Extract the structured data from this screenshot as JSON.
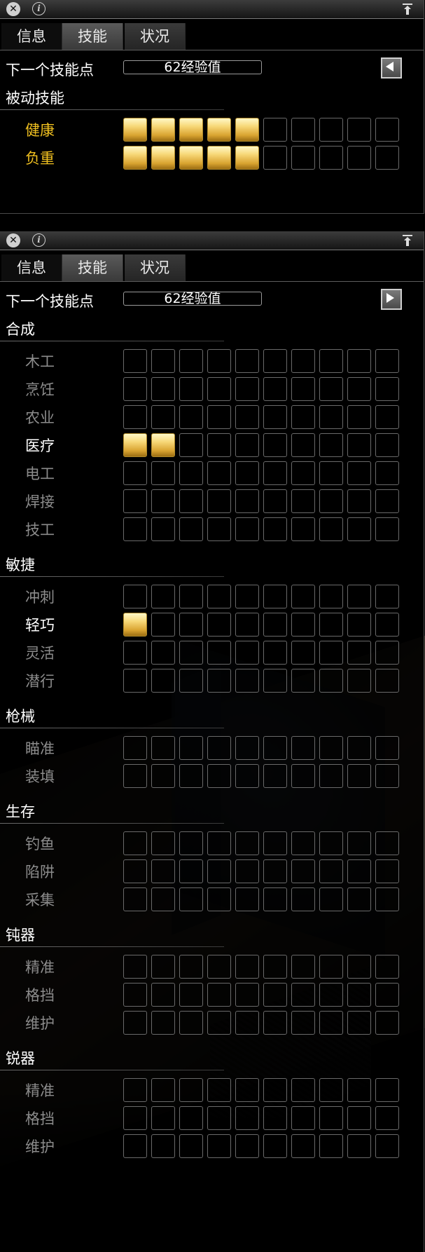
{
  "window1": {
    "tabs": [
      "信息",
      "技能",
      "状况"
    ],
    "active_tab": 1,
    "xp": {
      "label": "下一个技能点",
      "value": "62经验值",
      "button": "collapse"
    },
    "sections": [
      {
        "title": "被动技能",
        "skills": [
          {
            "name": "健康",
            "level": 5,
            "max": 10,
            "color": "#f0c020"
          },
          {
            "name": "负重",
            "level": 5,
            "max": 10,
            "color": "#f0c020"
          }
        ]
      }
    ]
  },
  "window2": {
    "tabs": [
      "信息",
      "技能",
      "状况"
    ],
    "active_tab": 1,
    "xp": {
      "label": "下一个技能点",
      "value": "62经验值",
      "button": "expand"
    },
    "sections": [
      {
        "title": "合成",
        "skills": [
          {
            "name": "木工",
            "level": 0,
            "max": 10
          },
          {
            "name": "烹饪",
            "level": 0,
            "max": 10
          },
          {
            "name": "农业",
            "level": 0,
            "max": 10
          },
          {
            "name": "医疗",
            "level": 2,
            "max": 10
          },
          {
            "name": "电工",
            "level": 0,
            "max": 10
          },
          {
            "name": "焊接",
            "level": 0,
            "max": 10
          },
          {
            "name": "技工",
            "level": 0,
            "max": 10
          }
        ]
      },
      {
        "title": "敏捷",
        "skills": [
          {
            "name": "冲刺",
            "level": 0,
            "max": 10
          },
          {
            "name": "轻巧",
            "level": 1,
            "max": 10
          },
          {
            "name": "灵活",
            "level": 0,
            "max": 10
          },
          {
            "name": "潜行",
            "level": 0,
            "max": 10
          }
        ]
      },
      {
        "title": "枪械",
        "skills": [
          {
            "name": "瞄准",
            "level": 0,
            "max": 10
          },
          {
            "name": "装填",
            "level": 0,
            "max": 10
          }
        ]
      },
      {
        "title": "生存",
        "skills": [
          {
            "name": "钓鱼",
            "level": 0,
            "max": 10
          },
          {
            "name": "陷阱",
            "level": 0,
            "max": 10
          },
          {
            "name": "采集",
            "level": 0,
            "max": 10
          }
        ]
      },
      {
        "title": "钝器",
        "skills": [
          {
            "name": "精准",
            "level": 0,
            "max": 10
          },
          {
            "name": "格挡",
            "level": 0,
            "max": 10
          },
          {
            "name": "维护",
            "level": 0,
            "max": 10
          }
        ]
      },
      {
        "title": "锐器",
        "skills": [
          {
            "name": "精准",
            "level": 0,
            "max": 10
          },
          {
            "name": "格挡",
            "level": 0,
            "max": 10
          },
          {
            "name": "维护",
            "level": 0,
            "max": 10
          }
        ]
      }
    ]
  },
  "colors": {
    "skill_active": "#ffffff",
    "skill_inactive": "#8c8c8c",
    "passive": "#f0c020",
    "cell_filled": "#e8c050"
  }
}
